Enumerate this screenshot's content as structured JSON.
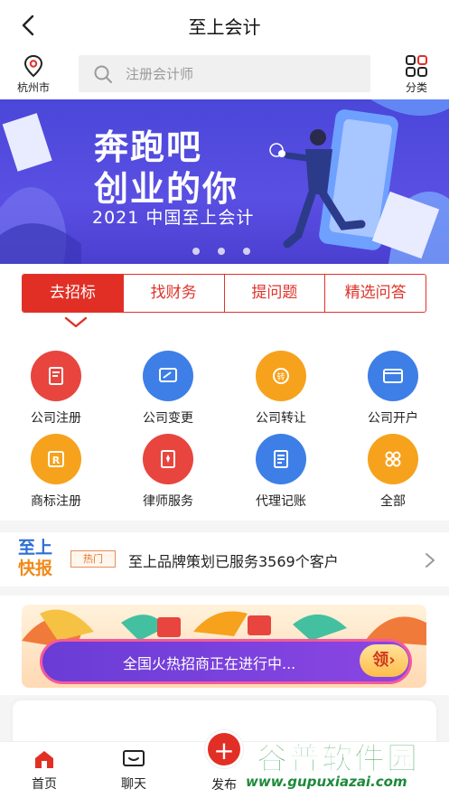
{
  "header": {
    "title": "至上会计"
  },
  "search": {
    "city": "杭州市",
    "placeholder": "注册会计师",
    "category_label": "分类"
  },
  "banner": {
    "line1": "奔跑吧",
    "line2": "创业的你",
    "sub": "2021 中国至上会计",
    "dot_count": 3
  },
  "tabs": [
    {
      "label": "去招标",
      "active": true
    },
    {
      "label": "找财务",
      "active": false
    },
    {
      "label": "提问题",
      "active": false
    },
    {
      "label": "精选问答",
      "active": false
    }
  ],
  "services": [
    {
      "label": "公司注册",
      "icon": "building-doc-icon",
      "color": "#e8453e"
    },
    {
      "label": "公司变更",
      "icon": "edit-card-icon",
      "color": "#3d7fe6"
    },
    {
      "label": "公司转让",
      "icon": "transfer-hand-icon",
      "color": "#f6a21c"
    },
    {
      "label": "公司开户",
      "icon": "bank-card-icon",
      "color": "#3d7fe6"
    },
    {
      "label": "商标注册",
      "icon": "trademark-icon",
      "color": "#f6a21c"
    },
    {
      "label": "律师服务",
      "icon": "lawyer-tie-icon",
      "color": "#e8453e"
    },
    {
      "label": "代理记账",
      "icon": "ledger-icon",
      "color": "#3d7fe6"
    },
    {
      "label": "全部",
      "icon": "all-grid-icon",
      "color": "#f6a21c"
    }
  ],
  "news": {
    "logo_top": "至上",
    "logo_bottom": "快报",
    "badge": "热门",
    "text": "至上品牌策划已服务3569个客户"
  },
  "promo": {
    "text": "全国火热招商正在进行中...",
    "button": "领"
  },
  "bottom_nav": {
    "home": "首页",
    "chat": "聊天",
    "publish": "发布"
  },
  "watermark": {
    "brand": "谷普软件园",
    "url": "www.gupuxiazai.com"
  },
  "colors": {
    "primary": "#e22f26",
    "banner": "#4a47d9",
    "blue": "#3d7fe6",
    "orange": "#f6a21c"
  }
}
